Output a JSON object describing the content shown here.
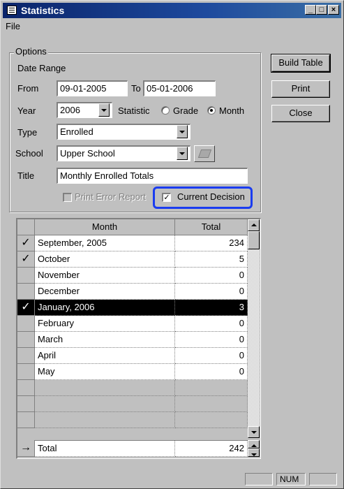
{
  "window": {
    "title": "Statistics"
  },
  "menu": {
    "file": "File"
  },
  "options": {
    "legend": "Options",
    "date_range_label": "Date Range",
    "from_label": "From",
    "from_value": "09-01-2005",
    "to_label": "To",
    "to_value": "05-01-2006",
    "year_label": "Year",
    "year_value": "2006",
    "statistic_label": "Statistic",
    "statistic_options": [
      "Grade",
      "Month"
    ],
    "statistic_selected": "Month",
    "type_label": "Type",
    "type_value": "Enrolled",
    "school_label": "School",
    "school_value": "Upper School",
    "title_label": "Title",
    "title_value": "Monthly Enrolled Totals",
    "print_error_label": "Print Error Report",
    "print_error_checked": false,
    "current_decision_label": "Current Decision",
    "current_decision_checked": true
  },
  "buttons": {
    "build_table": "Build Table",
    "print": "Print",
    "close": "Close"
  },
  "grid": {
    "headers": [
      "Month",
      "Total"
    ],
    "rows": [
      {
        "check": "✓",
        "month": "September, 2005",
        "total": "234"
      },
      {
        "check": "✓",
        "month": "October",
        "total": "5"
      },
      {
        "check": "",
        "month": "November",
        "total": "0"
      },
      {
        "check": "",
        "month": "December",
        "total": "0"
      },
      {
        "check": "✓",
        "month": "January, 2006",
        "total": "3"
      },
      {
        "check": "",
        "month": "February",
        "total": "0"
      },
      {
        "check": "",
        "month": "March",
        "total": "0"
      },
      {
        "check": "",
        "month": "April",
        "total": "0"
      },
      {
        "check": "",
        "month": "May",
        "total": "0"
      }
    ],
    "selected_row": "January, 2006",
    "total_marker": "→",
    "total_label": "Total",
    "total_value": "242"
  },
  "status": {
    "num": "NUM"
  }
}
